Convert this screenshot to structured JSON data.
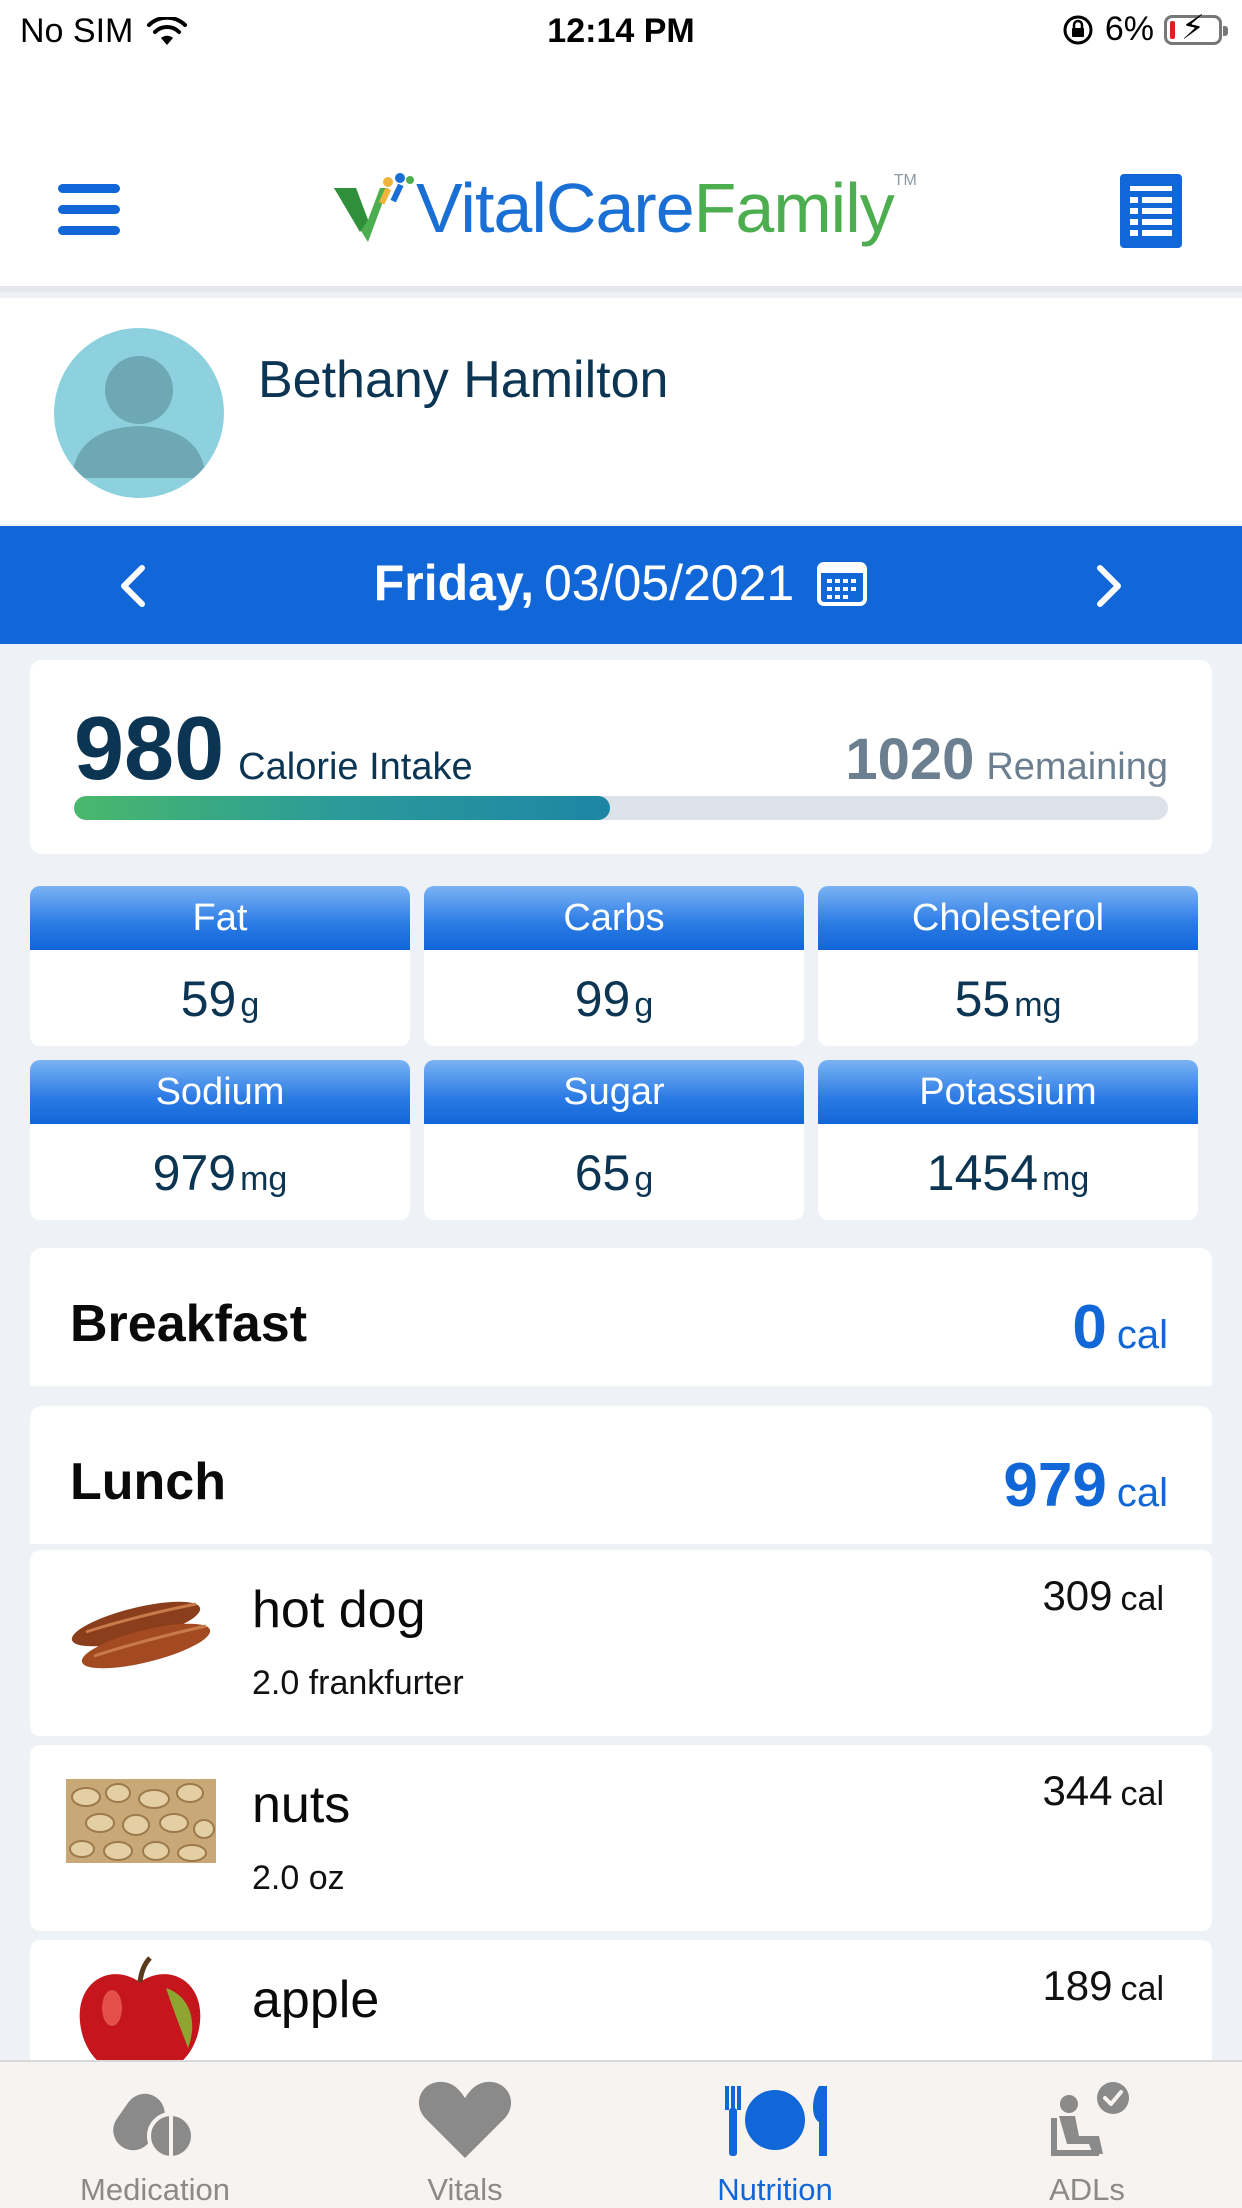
{
  "status_bar": {
    "carrier": "No SIM",
    "time": "12:14 PM",
    "battery": "6%",
    "icons": [
      "wifi-icon",
      "orientation-lock-icon",
      "battery-charging-icon"
    ]
  },
  "header": {
    "logo_part1": "VitalCare",
    "logo_part2": "Family",
    "logo_tm": "TM",
    "icons": [
      "hamburger-menu-icon",
      "report-list-icon"
    ]
  },
  "profile": {
    "name": "Bethany Hamilton"
  },
  "date_bar": {
    "day": "Friday,",
    "date": "03/05/2021"
  },
  "calories": {
    "intake": "980",
    "intake_label": "Calorie Intake",
    "remaining": "1020",
    "remaining_label": "Remaining",
    "progress_fraction": 0.49
  },
  "nutrients": [
    {
      "name": "Fat",
      "value": "59",
      "unit": "g"
    },
    {
      "name": "Carbs",
      "value": "99",
      "unit": "g"
    },
    {
      "name": "Cholesterol",
      "value": "55",
      "unit": "mg"
    },
    {
      "name": "Sodium",
      "value": "979",
      "unit": "mg"
    },
    {
      "name": "Sugar",
      "value": "65",
      "unit": "g"
    },
    {
      "name": "Potassium",
      "value": "1454",
      "unit": "mg"
    }
  ],
  "meals": {
    "breakfast": {
      "title": "Breakfast",
      "calories": "0",
      "unit": "cal"
    },
    "lunch": {
      "title": "Lunch",
      "calories": "979",
      "unit": "cal"
    }
  },
  "lunch_items": [
    {
      "name": "hot dog",
      "portion": "2.0 frankfurter",
      "calories": "309",
      "unit": "cal"
    },
    {
      "name": "nuts",
      "portion": "2.0 oz",
      "calories": "344",
      "unit": "cal"
    },
    {
      "name": "apple",
      "portion": "",
      "calories": "189",
      "unit": "cal"
    }
  ],
  "tabs": [
    {
      "label": "Medication",
      "icon": "pills-icon",
      "active": false
    },
    {
      "label": "Vitals",
      "icon": "heart-icon",
      "active": false
    },
    {
      "label": "Nutrition",
      "icon": "plate-cutlery-icon",
      "active": true
    },
    {
      "label": "ADLs",
      "icon": "person-check-icon",
      "active": false
    }
  ],
  "colors": {
    "primary": "#1166d8",
    "text_dark": "#0b3552",
    "logo_green": "#4cae4f",
    "tab_inactive": "#8a8a8a"
  }
}
